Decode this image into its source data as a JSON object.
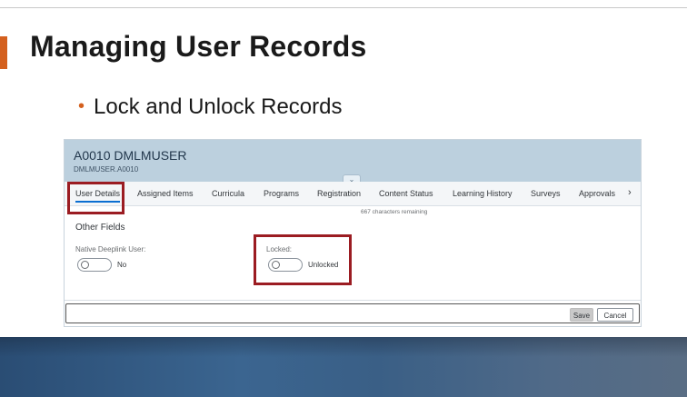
{
  "slide": {
    "title": "Managing User Records",
    "bullet": "Lock and Unlock Records"
  },
  "colors": {
    "accent": "#d4601e",
    "highlight": "#9b1c22",
    "header": "#bcd0de",
    "tab_underline": "#0a6ed1"
  },
  "record": {
    "title": "A0010 DMLMUSER",
    "subtitle": "DMLMUSER.A0010"
  },
  "tabs": [
    {
      "label": "User Details",
      "active": true
    },
    {
      "label": "Assigned Items",
      "active": false
    },
    {
      "label": "Curricula",
      "active": false
    },
    {
      "label": "Programs",
      "active": false
    },
    {
      "label": "Registration",
      "active": false
    },
    {
      "label": "Content Status",
      "active": false
    },
    {
      "label": "Learning History",
      "active": false
    },
    {
      "label": "Surveys",
      "active": false
    },
    {
      "label": "Approvals",
      "active": false
    }
  ],
  "tab_next_icon": "chevron-right-icon",
  "collapse_icon": "chevron-down-icon",
  "chars_remaining": "667 characters remaining",
  "section": {
    "title": "Other Fields"
  },
  "fields": {
    "deeplink": {
      "label": "Native Deeplink User:",
      "state": "No",
      "on": false
    },
    "locked": {
      "label": "Locked:",
      "state": "Unlocked",
      "on": false
    }
  },
  "footer": {
    "save": "Save",
    "cancel": "Cancel"
  }
}
